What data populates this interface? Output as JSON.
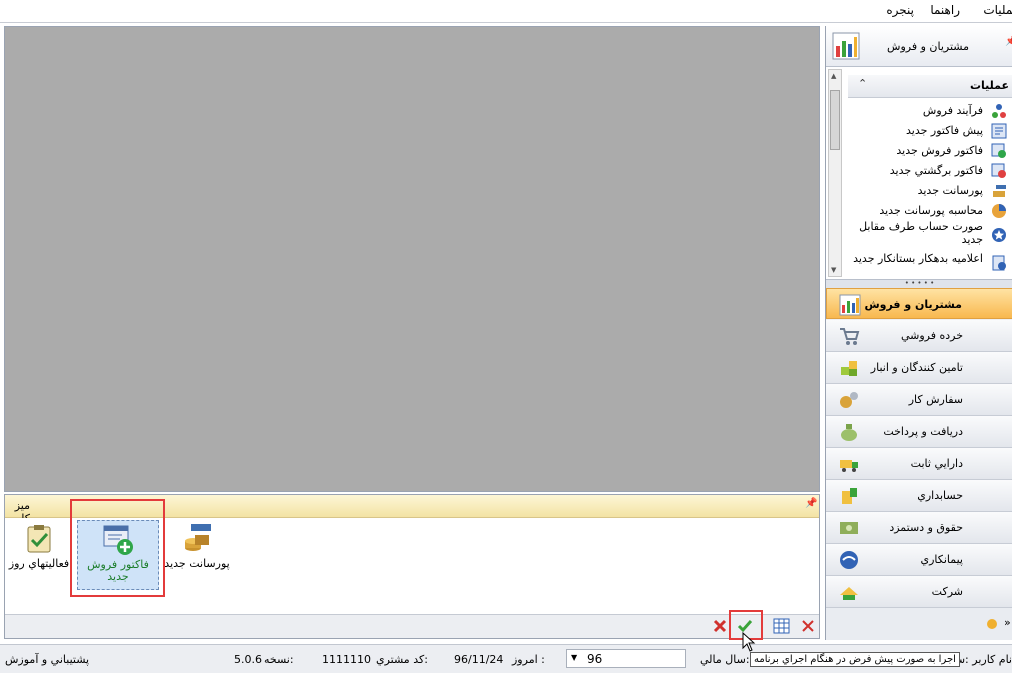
{
  "menu": {
    "items": [
      "عملیات",
      "راهنما",
      "پنجره"
    ]
  },
  "desk": {
    "title": "میز کار",
    "pin": "📌",
    "tiles": [
      {
        "label": "پورسانت جديد",
        "icon": "commission-icon"
      },
      {
        "label": "فاكتور فروش جديد",
        "icon": "new-invoice-icon"
      },
      {
        "label": "فعالیتهاي روز",
        "icon": "daily-activities-icon"
      }
    ]
  },
  "sidebar": {
    "header_title": "مشتريان و فروش",
    "pin": "📌",
    "task_title": "عمليات",
    "operations": [
      "فرآيند فروش",
      "پيش فاكتور جديد",
      "فاكتور فروش جديد",
      "فاكتور برگشتي جديد",
      "پورسانت جديد",
      "محاسبه پورسانت جديد",
      "صورت حساب طرف مقابل جديد",
      "اعلاميه بدهكار بستانكار جديد"
    ],
    "nav": [
      "مشتريان و فروش",
      "خرده فروشي",
      "تامين كنندگان و انبار",
      "سفارش كار",
      "دريافت و پرداخت",
      "دارايي ثابت",
      "حسابداري",
      "حقوق و دستمزد",
      "پيمانكاري",
      "شركت"
    ]
  },
  "status": {
    "support": "پشتيباني و آموزش",
    "version_label": "نسخه:",
    "version": "5.0.6",
    "customer_code_label": "كد مشتري:",
    "customer_code": "1111110",
    "today_label": "امروز :",
    "today": "96/11/24",
    "fiscal_year_value": "96",
    "fiscal_year_label": "سال مالي:",
    "user_label": "نام كاربر :سرپرست",
    "tooltip": "اجرا به صورت پيش فرض در هنگام اجراي برنامه"
  },
  "colors": {
    "accent_active": "#f8b84f",
    "highlight_box": "#e33b3b",
    "selected_tile": "#cfe3f8"
  }
}
